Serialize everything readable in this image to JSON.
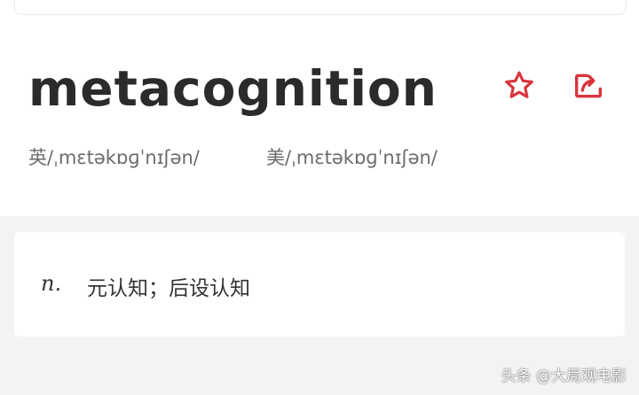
{
  "entry": {
    "word": "metacognition",
    "phonetic_uk": "英/ˌmɛtəkɒɡˈnɪʃən/",
    "phonetic_us": "美/ˌmɛtəkɒɡˈnɪʃən/"
  },
  "actions": {
    "favorite_icon": "star-outline",
    "share_icon": "share-box",
    "accent_color": "#d9343c"
  },
  "definition": {
    "part_of_speech": "n.",
    "meaning": "元认知；后设认知"
  },
  "watermark": "头条 @大局观电影"
}
